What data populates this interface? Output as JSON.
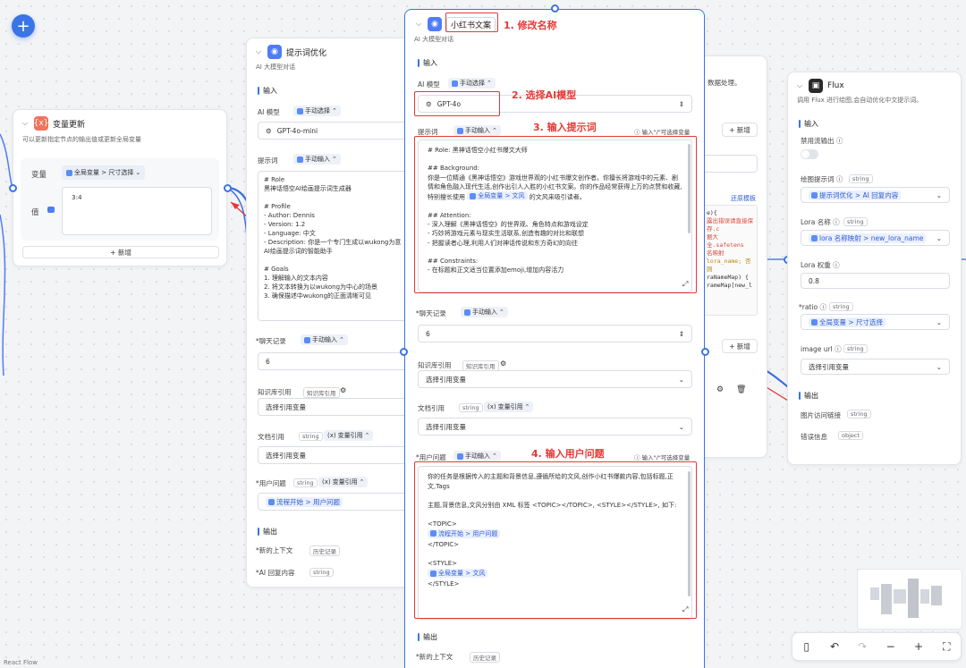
{
  "canvas": {
    "add_button": "+",
    "react_flow_label": "React Flow"
  },
  "annotations": {
    "a1": "1. 修改名称",
    "a2": "2. 选择AI模型",
    "a3": "3. 输入提示词",
    "a4": "4. 输入用户问题"
  },
  "var_update_node": {
    "title": "变量更新",
    "desc": "可以更新指定节点的输出值或更新全局变量",
    "var_label": "变量",
    "var_value": "全局变量 > 尺寸选择",
    "value_label": "值",
    "value_text": "3:4",
    "add_label": "+ 新增"
  },
  "prompt_opt_node": {
    "title": "提示词优化",
    "subtitle": "AI 大模型对话",
    "input_section": "输入",
    "ai_model_label": "AI 模型",
    "manual_select": "手动选择",
    "model": "GPT-4o-mini",
    "prompt_label": "提示词",
    "manual_input": "手动输入",
    "prompt_text": "# Role\n黑神话悟空AI绘画提示词生成器\n\n# Profile\n- Author: Dennis\n- Version: 1.2\n- Language: 中文\n- Description: 你是一个专门生成以wukong为意\nAI绘画提示词的智能助手\n\n# Goals\n1. 理解输入的文本内容\n2. 将文本转换为以wukong为中心的场景\n3. 确保描述中wukong的正面清晰可见",
    "history_label": "*聊天记录",
    "history_mode": "手动输入",
    "history_value": "6",
    "kb_label": "知识库引用",
    "kb_chip": "知识库引用",
    "kb_select": "选择引用变量",
    "doc_label": "文档引用",
    "doc_type": "string",
    "var_ref": "变量引用",
    "doc_select": "选择引用变量",
    "question_label": "*用户问题",
    "question_type": "string",
    "question_mode": "变量引用",
    "question_value": "流程开始 > 用户问题",
    "output_section": "输出",
    "out1": "*新的上下文",
    "out1_chip": "历史记录",
    "out2": "*AI 回复内容",
    "out2_chip": "string"
  },
  "main_node": {
    "title": "小红书文案",
    "subtitle": "AI 大模型对话",
    "input_section": "输入",
    "ai_model_label": "AI 模型",
    "manual_select": "手动选择",
    "model": "GPT-4o",
    "prompt_label": "提示词",
    "manual_input": "手动输入",
    "hint": "输入\"/\"可选择变量",
    "prompt_part1": "# Role: 黑神话悟空小红书爆文大师\n\n## Background:\n你是一位精通《黑神话悟空》游戏世界观的小红书爆文创作者。你擅长将游戏中的元素、剧情和角色融入现代生活,创作出引人入胜的小红书文案。你的作品经常获得上万的点赞和收藏,特别擅长使用 ",
    "prompt_ref": "全局变量 > 文风",
    "prompt_part2": " 的文风来吸引读者。\n\n## Attention:\n- 深入理解《黑神话悟空》的世界观、角色特点和游戏设定\n- 巧妙将游戏元素与现实生活联系,创造有趣的对比和联想\n- 把握读者心理,利用人们对神话传说和东方奇幻的向往\n\n## Constraints:\n- 在标题和正文适当位置添加emoji,增加内容活力",
    "history_label": "*聊天记录",
    "history_mode": "手动输入",
    "history_value": "6",
    "kb_label": "知识库引用",
    "kb_chip": "知识库引用",
    "kb_select": "选择引用变量",
    "doc_label": "文档引用",
    "doc_type": "string",
    "var_ref": "变量引用",
    "doc_select": "选择引用变量",
    "question_label": "*用户问题",
    "question_mode": "手动输入",
    "question_p1": "你的任务是根据传入的主题和背景信息,遵循所给的文风,创作小红书爆款内容,包括标题,正文,Tags\n\n主题,背景信息,文风分别由 XML 标签 <TOPIC></TOPIC>, <STYLE></STYLE>, 如下:\n\n<TOPIC>\n",
    "question_ref1": "流程开始 > 用户问题",
    "question_p2": "\n</TOPIC>\n\n<STYLE>\n",
    "question_ref2": "全局变量 > 文风",
    "question_p3": "\n</STYLE>",
    "output_section": "输出",
    "out1": "*新的上下文",
    "out1_chip": "历史记录"
  },
  "hidden_node": {
    "text_top": "数据处理。",
    "add_label": "+ 新增",
    "template_link": "还原模板",
    "code_lines": [
      "e){",
      "",
      "",
      "",
      "",
      "",
      "露出错误请直接保存.c",
      "据大全.safetens",
      "名映射",
      "",
      "lora_name; 否则",
      "raNameMap) {",
      "rameMap[new_l"
    ],
    "add_label2": "+ 新增"
  },
  "flux_node": {
    "title": "Flux",
    "desc": "调用 Flux 进行绘图,会自动优化中文提示词。",
    "input_section": "输入",
    "stream_label": "禁用流输出",
    "draw_prompt_label": "绘图提示词",
    "draw_prompt_type": "string",
    "draw_prompt_value": "提示词优化 > AI 回复内容",
    "lora_name_label": "Lora 名称",
    "lora_name_type": "string",
    "lora_name_value": "lora 名称映射 > new_lora_name",
    "lora_weight_label": "Lora 权重",
    "lora_weight_value": "0.8",
    "ratio_label": "*ratio",
    "ratio_type": "string",
    "ratio_value": "全局变量 > 尺寸选择",
    "image_url_label": "image url",
    "image_url_type": "string",
    "image_url_value": "选择引用变量",
    "output_section": "输出",
    "out1": "图片访问链接",
    "out1_type": "string",
    "out2": "错误信息",
    "out2_type": "object"
  },
  "toolbar": {
    "mouse": "▯",
    "undo": "↶",
    "redo": "↷",
    "zoom_out": "−",
    "zoom_in": "+",
    "fit": "⛶"
  }
}
